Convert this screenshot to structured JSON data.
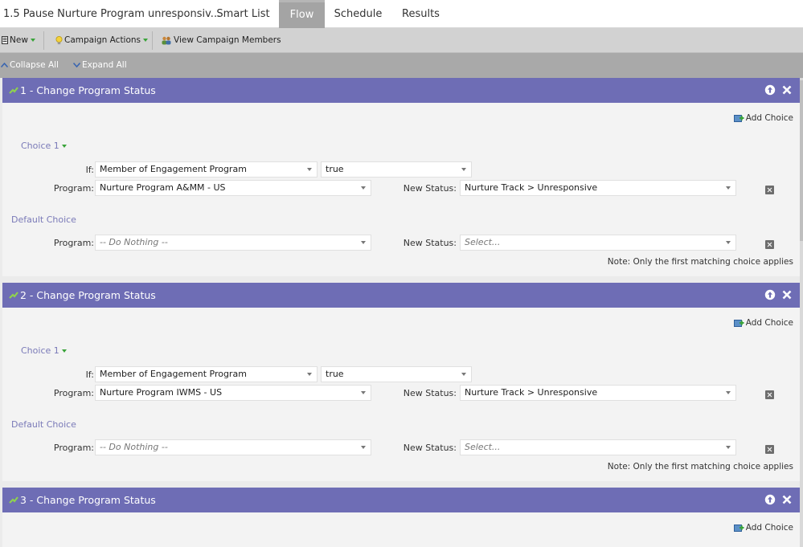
{
  "program_title": "1.5 Pause Nurture Program unresponsiv...",
  "tabs": [
    {
      "label": "Smart List"
    },
    {
      "label": "Flow"
    },
    {
      "label": "Schedule"
    },
    {
      "label": "Results"
    }
  ],
  "toolbar": {
    "new_label": "New",
    "campaign_actions_label": "Campaign Actions",
    "view_members_label": "View Campaign Members"
  },
  "subbar": {
    "collapse_all": "Collapse All",
    "expand_all": "Expand All"
  },
  "steps": [
    {
      "title": "1 - Change Program Status",
      "add_choice": "Add Choice",
      "choice_label": "Choice 1",
      "if_label": "If:",
      "if_field": "Member of Engagement Program",
      "if_value": "true",
      "program_label": "Program:",
      "program_value": "Nurture Program A&MM - US",
      "new_status_label": "New Status:",
      "new_status_value": "Nurture Track > Unresponsive",
      "default_label": "Default Choice",
      "default_program": "-- Do Nothing --",
      "default_status": "Select...",
      "note": "Note: Only the first matching choice applies"
    },
    {
      "title": "2 - Change Program Status",
      "add_choice": "Add Choice",
      "choice_label": "Choice 1",
      "if_label": "If:",
      "if_field": "Member of Engagement Program",
      "if_value": "true",
      "program_label": "Program:",
      "program_value": "Nurture Program IWMS - US",
      "new_status_label": "New Status:",
      "new_status_value": "Nurture Track > Unresponsive",
      "default_label": "Default Choice",
      "default_program": "-- Do Nothing --",
      "default_status": "Select...",
      "note": "Note: Only the first matching choice applies"
    },
    {
      "title": "3 - Change Program Status",
      "add_choice": "Add Choice"
    }
  ],
  "colors": {
    "step_header": "#6e6db5",
    "active_tab": "#a4a4a4",
    "choice_label": "#7a7ab8"
  }
}
